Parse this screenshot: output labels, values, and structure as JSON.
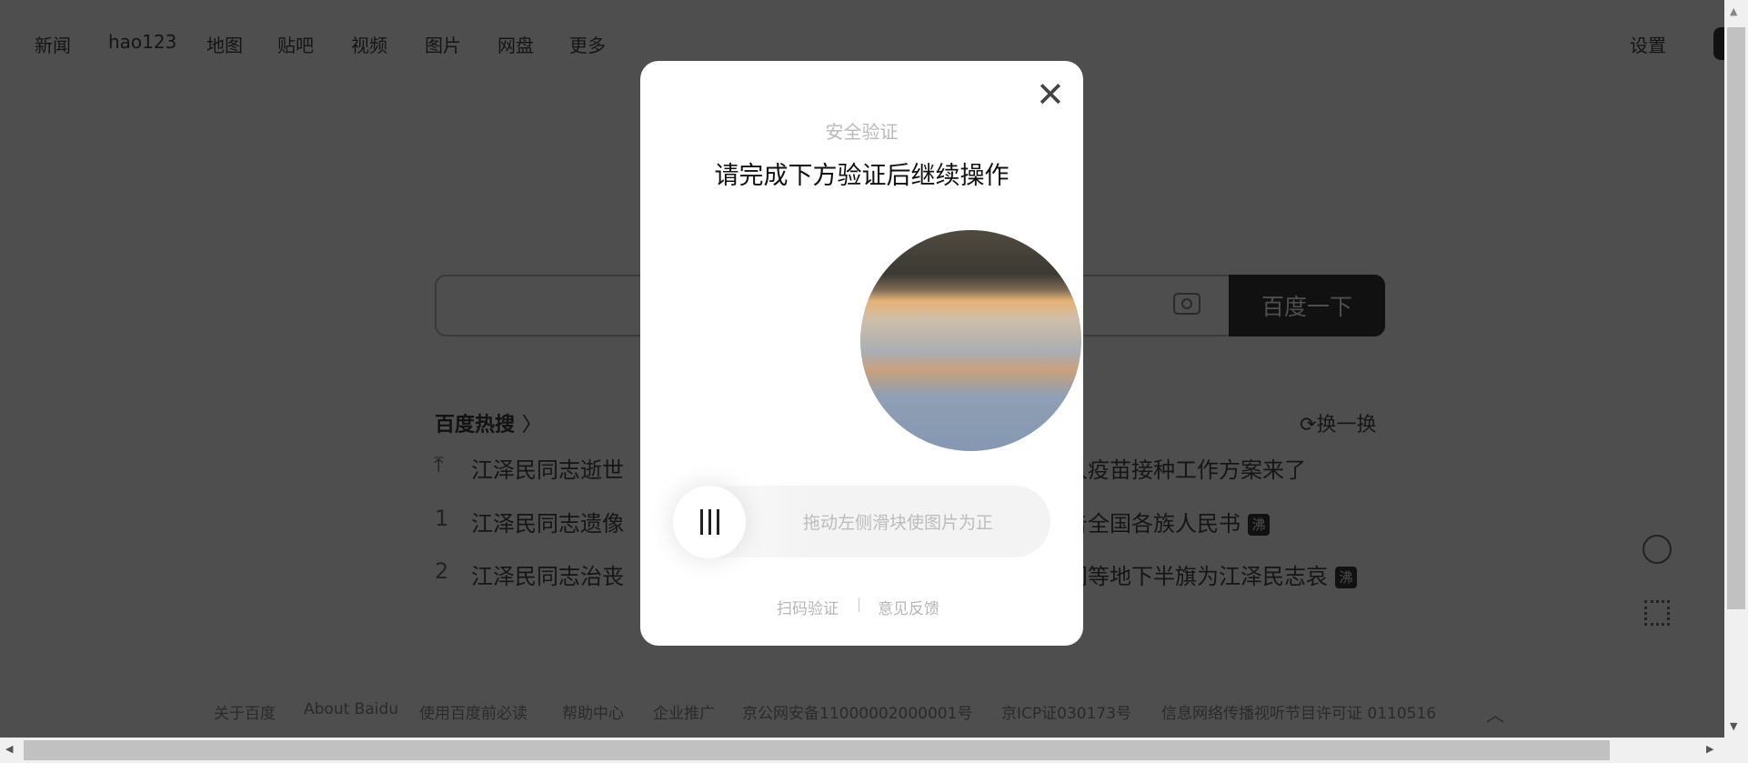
{
  "nav": {
    "items": [
      "新闻",
      "hao123",
      "地图",
      "贴吧",
      "视频",
      "图片",
      "网盘",
      "更多"
    ],
    "settings": "设置"
  },
  "search": {
    "button": "百度一下",
    "camera_icon": "camera-icon"
  },
  "hot": {
    "title": "百度热搜",
    "refresh": "换一换",
    "left": [
      {
        "idx": "",
        "text": "江泽民同志逝世"
      },
      {
        "idx": "1",
        "text": "江泽民同志遗像"
      },
      {
        "idx": "2",
        "text": "江泽民同志治丧"
      }
    ],
    "right": [
      {
        "text": "人疫苗接种工作方案来了",
        "tag": ""
      },
      {
        "text": "告全国各族人民书",
        "tag": "沸"
      },
      {
        "text": "门等地下半旗为江泽民志哀",
        "tag": "沸"
      }
    ]
  },
  "footer": [
    "关于百度",
    "About Baidu",
    "使用百度前必读",
    "帮助中心",
    "企业推广",
    "京公网安备11000002000001号",
    "京ICP证030173号",
    "信息网络传播视听节目许可证 0110516"
  ],
  "modal": {
    "subtitle": "安全验证",
    "title": "请完成下方验证后继续操作",
    "slider_hint": "拖动左侧滑块使图片为正",
    "scan": "扫码验证",
    "sep": "|",
    "feedback": "意见反馈"
  }
}
